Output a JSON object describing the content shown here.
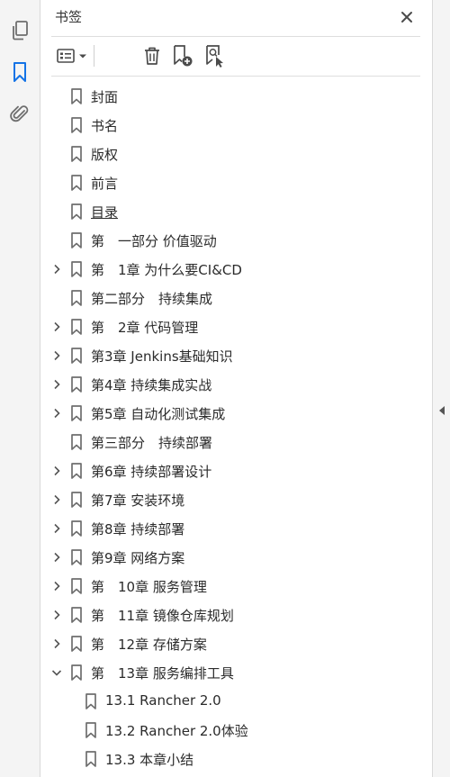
{
  "panel": {
    "title": "书签"
  },
  "rail": {
    "items": [
      {
        "name": "pages-icon",
        "active": false
      },
      {
        "name": "bookmark-icon",
        "active": true
      },
      {
        "name": "attachment-icon",
        "active": false
      }
    ]
  },
  "toolbar": {
    "buttons": [
      "options-menu-icon",
      "delete-bookmark-icon",
      "new-bookmark-icon",
      "find-bookmark-icon"
    ]
  },
  "bookmarks": [
    {
      "label": "封面",
      "level": 0,
      "expander": "none"
    },
    {
      "label": "书名",
      "level": 0,
      "expander": "none"
    },
    {
      "label": "版权",
      "level": 0,
      "expander": "none"
    },
    {
      "label": "前言",
      "level": 0,
      "expander": "none"
    },
    {
      "label": "目录",
      "level": 0,
      "expander": "none",
      "underline": true
    },
    {
      "label": "第　一部分 价值驱动",
      "level": 0,
      "expander": "none"
    },
    {
      "label": "第　1章 为什么要CI&CD",
      "level": 0,
      "expander": "collapsed"
    },
    {
      "label": "第二部分　持续集成",
      "level": 0,
      "expander": "none"
    },
    {
      "label": "第　2章 代码管理",
      "level": 0,
      "expander": "collapsed"
    },
    {
      "label": "第3章 Jenkins基础知识",
      "level": 0,
      "expander": "collapsed"
    },
    {
      "label": "第4章 持续集成实战",
      "level": 0,
      "expander": "collapsed"
    },
    {
      "label": "第5章 自动化测试集成",
      "level": 0,
      "expander": "collapsed"
    },
    {
      "label": "第三部分　持续部署",
      "level": 0,
      "expander": "none"
    },
    {
      "label": "第6章 持续部署设计",
      "level": 0,
      "expander": "collapsed"
    },
    {
      "label": "第7章 安装环境",
      "level": 0,
      "expander": "collapsed"
    },
    {
      "label": "第8章 持续部署",
      "level": 0,
      "expander": "collapsed"
    },
    {
      "label": "第9章 网络方案",
      "level": 0,
      "expander": "collapsed"
    },
    {
      "label": "第　10章 服务管理",
      "level": 0,
      "expander": "collapsed"
    },
    {
      "label": "第　11章 镜像仓库规划",
      "level": 0,
      "expander": "collapsed"
    },
    {
      "label": "第　12章 存储方案",
      "level": 0,
      "expander": "collapsed"
    },
    {
      "label": "第　13章 服务编排工具",
      "level": 0,
      "expander": "expanded"
    },
    {
      "label": "13.1 Rancher 2.0",
      "level": 1,
      "expander": "none"
    },
    {
      "label": "13.2 Rancher 2.0体验",
      "level": 1,
      "expander": "none"
    },
    {
      "label": "13.3 本章小结",
      "level": 1,
      "expander": "none"
    }
  ],
  "colors": {
    "accent": "#1473e6",
    "icon": "#6e6e6e",
    "text": "#2b2b2b"
  }
}
